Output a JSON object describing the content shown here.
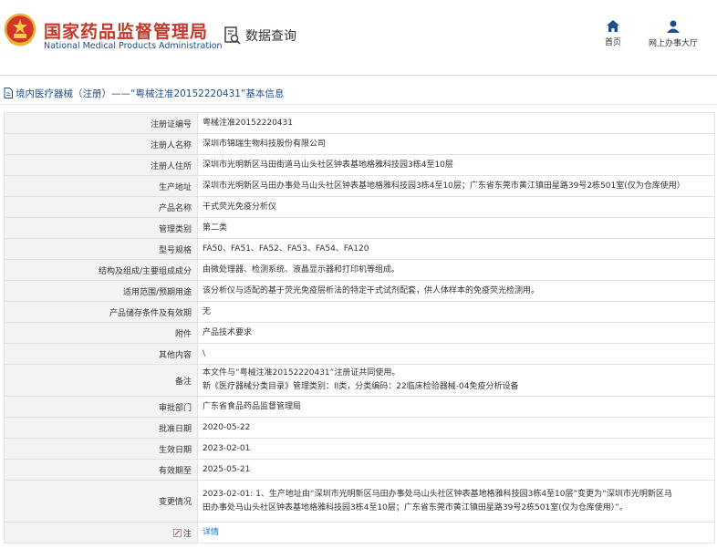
{
  "header": {
    "title": "国家药品监督管理局",
    "subtitle": "National Medical Products Administration",
    "query_label": "数据查询",
    "nav": [
      {
        "label": "首页",
        "icon": "home-icon"
      },
      {
        "label": "网上办事大厅",
        "icon": "user-icon"
      }
    ]
  },
  "breadcrumb": {
    "text": "境内医疗器械（注册）——“粤械注准20152220431”基本信息"
  },
  "rows": [
    {
      "label": "注册证编号",
      "value": "粤械注准20152220431"
    },
    {
      "label": "注册人名称",
      "value": "深圳市锦瑞生物科技股份有限公司"
    },
    {
      "label": "注册人住所",
      "value": "深圳市光明新区马田街道马山头社区钟表基地格雅科技园3栋4至10层"
    },
    {
      "label": "生产地址",
      "value": "深圳市光明新区马田办事处马山头社区钟表基地格雅科技园3栋4至10层；广东省东莞市黄江镇田星路39号2栋501室(仅为仓库使用）"
    },
    {
      "label": "产品名称",
      "value": "干式荧光免疫分析仪"
    },
    {
      "label": "管理类别",
      "value": "第二类"
    },
    {
      "label": "型号规格",
      "value": "FA50、FA51、FA52、FA53、FA54、FA120"
    },
    {
      "label": "结构及组成/主要组成成分",
      "value": "由微处理器、检测系统、液晶显示器和打印机等组成。"
    },
    {
      "label": "适用范围/预期用途",
      "value": "该分析仪与适配的基于荧光免疫层析法的特定干式试剂配套，供人体样本的免疫荧光检测用。"
    },
    {
      "label": "产品储存条件及有效期",
      "value": "无"
    },
    {
      "label": "附件",
      "value": "产品技术要求"
    },
    {
      "label": "其他内容",
      "value": "\\"
    },
    {
      "label": "备注",
      "lines": [
        "本文件与“粤械注准20152220431”注册证共同使用。",
        "新《医疗器械分类目录》管理类别：II类，分类编码：22临床检验器械-04免疫分析设备"
      ]
    },
    {
      "label": "审批部门",
      "value": "广东省食品药品监督管理局"
    },
    {
      "label": "批准日期",
      "value": "2020-05-22"
    },
    {
      "label": "生效日期",
      "value": "2023-02-01"
    },
    {
      "label": "有效期至",
      "value": "2025-05-21"
    },
    {
      "label": "变更情况",
      "lines": [
        "2023-02-01: 1、生产地址由“深圳市光明新区马田办事处马山头社区钟表基地格雅科技园3栋4至10层”变更为“深圳市光明新区马",
        "田办事处马山头社区钟表基地格雅科技园3栋4至10层；广东省东莞市黄江镇田星路39号2栋501室(仅为仓库使用）”。"
      ]
    },
    {
      "label": "注",
      "value": "详情",
      "icon": "note-icon"
    }
  ],
  "colors": {
    "title_red": "#c0392b",
    "subtitle_blue": "#1f4e8c",
    "link_blue": "#1f6fc2",
    "label_bg": "#f3f3f3"
  }
}
